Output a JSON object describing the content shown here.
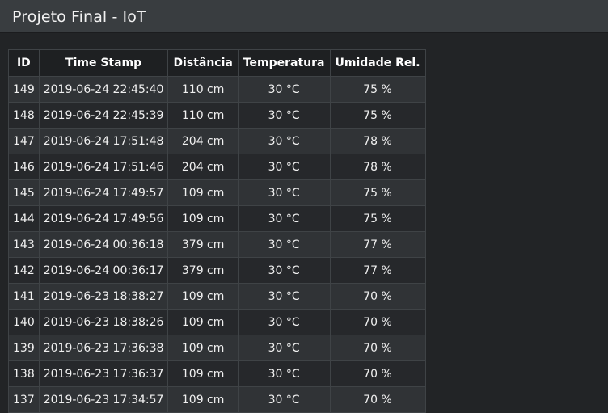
{
  "navbar": {
    "brand": "Projeto Final - IoT"
  },
  "table": {
    "headers": [
      "ID",
      "Time Stamp",
      "Distância",
      "Temperatura",
      "Umidade Rel."
    ],
    "rows": [
      [
        "149",
        "2019-06-24 22:45:40",
        "110 cm",
        "30 °C",
        "75 %"
      ],
      [
        "148",
        "2019-06-24 22:45:39",
        "110 cm",
        "30 °C",
        "75 %"
      ],
      [
        "147",
        "2019-06-24 17:51:48",
        "204 cm",
        "30 °C",
        "78 %"
      ],
      [
        "146",
        "2019-06-24 17:51:46",
        "204 cm",
        "30 °C",
        "78 %"
      ],
      [
        "145",
        "2019-06-24 17:49:57",
        "109 cm",
        "30 °C",
        "75 %"
      ],
      [
        "144",
        "2019-06-24 17:49:56",
        "109 cm",
        "30 °C",
        "75 %"
      ],
      [
        "143",
        "2019-06-24 00:36:18",
        "379 cm",
        "30 °C",
        "77 %"
      ],
      [
        "142",
        "2019-06-24 00:36:17",
        "379 cm",
        "30 °C",
        "77 %"
      ],
      [
        "141",
        "2019-06-23 18:38:27",
        "109 cm",
        "30 °C",
        "70 %"
      ],
      [
        "140",
        "2019-06-23 18:38:26",
        "109 cm",
        "30 °C",
        "70 %"
      ],
      [
        "139",
        "2019-06-23 17:36:38",
        "109 cm",
        "30 °C",
        "70 %"
      ],
      [
        "138",
        "2019-06-23 17:36:37",
        "109 cm",
        "30 °C",
        "70 %"
      ],
      [
        "137",
        "2019-06-23 17:34:57",
        "109 cm",
        "30 °C",
        "70 %"
      ]
    ]
  },
  "colors": {
    "page_background": "#222426",
    "navbar_background": "#393d40",
    "header_background": "#1e2022",
    "row_odd": "#303336",
    "row_even": "#26282b",
    "border": "#3f4346"
  }
}
